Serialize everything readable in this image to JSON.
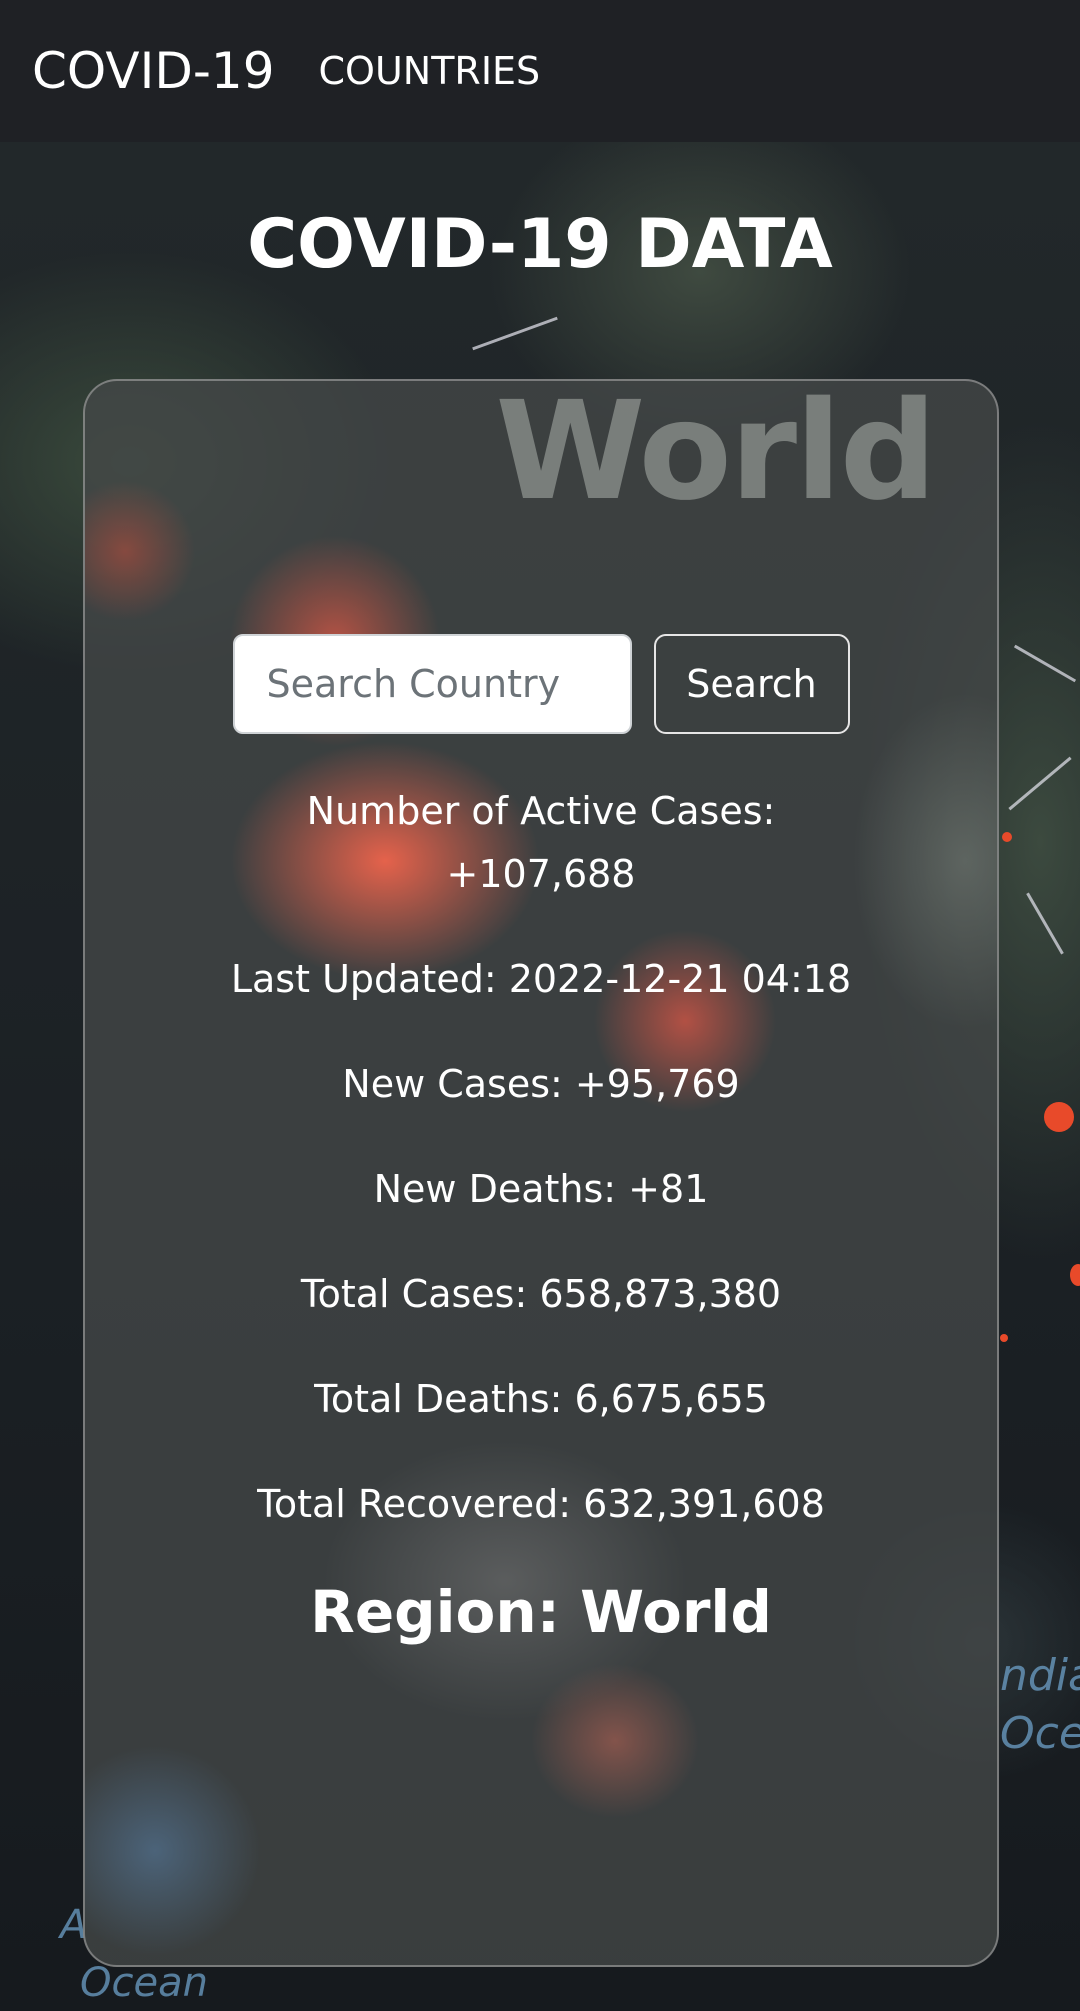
{
  "navbar": {
    "brand": "COVID-19",
    "link_countries": "COUNTRIES"
  },
  "page": {
    "title": "COVID-19 DATA"
  },
  "card": {
    "watermark": "World",
    "search": {
      "placeholder": "Search Country",
      "value": "",
      "button_label": "Search"
    },
    "stats": {
      "active_cases": "Number of Active Cases: +107,688",
      "last_updated": "Last Updated: 2022-12-21 04:18",
      "new_cases": "New Cases: +95,769",
      "new_deaths": "New Deaths: +81",
      "total_cases": "Total Cases: 658,873,380",
      "total_deaths": "Total Deaths: 6,675,655",
      "total_recovered": "Total Recovered: 632,391,608"
    },
    "region": "Region: World"
  },
  "background": {
    "ocean_label_1": "Ocean",
    "ocean_label_2": "ndia",
    "ocean_label_3": "Oce",
    "ocean_label_4": "A"
  },
  "colors": {
    "navbar_bg": "#1f2125",
    "accent_red": "#e84a2a",
    "text": "#ffffff"
  }
}
